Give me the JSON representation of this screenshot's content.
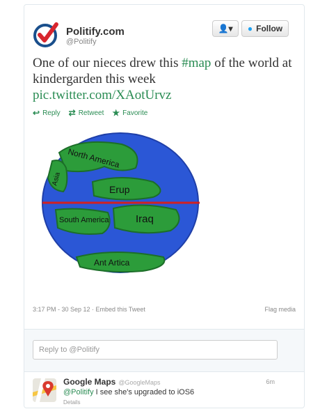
{
  "header": {
    "name": "Politify.com",
    "handle": "@Politify",
    "user_button": "👤▾",
    "follow_label": "Follow",
    "brand_color": "#d8262e"
  },
  "tweet": {
    "text_before": "One of our nieces drew this ",
    "hashtag": "#map",
    "text_after": " of the world at kindergarden this week ",
    "link": "pic.twitter.com/XAotUrvz",
    "actions": {
      "reply": "Reply",
      "retweet": "Retweet",
      "favorite": "Favorite"
    },
    "meta": "3:17 PM - 30 Sep 12 · Embed this Tweet",
    "flag": "Flag media"
  },
  "drawing": {
    "labels": {
      "north_america": "North America",
      "asia": "Asia",
      "europe": "Erup",
      "south_america": "South America",
      "iraq": "Iraq",
      "antarctica": "Ant Artica"
    },
    "colors": {
      "ocean": "#2b57d6",
      "land": "#2c9c3a",
      "equator": "#d22020"
    }
  },
  "reply_box": {
    "placeholder": "Reply to @Politify"
  },
  "reply": {
    "name": "Google Maps",
    "handle": "@GoogleMaps",
    "time": "6m",
    "mention": "@Politify",
    "text": " I see she's upgraded to iOS6",
    "details": "Details"
  }
}
